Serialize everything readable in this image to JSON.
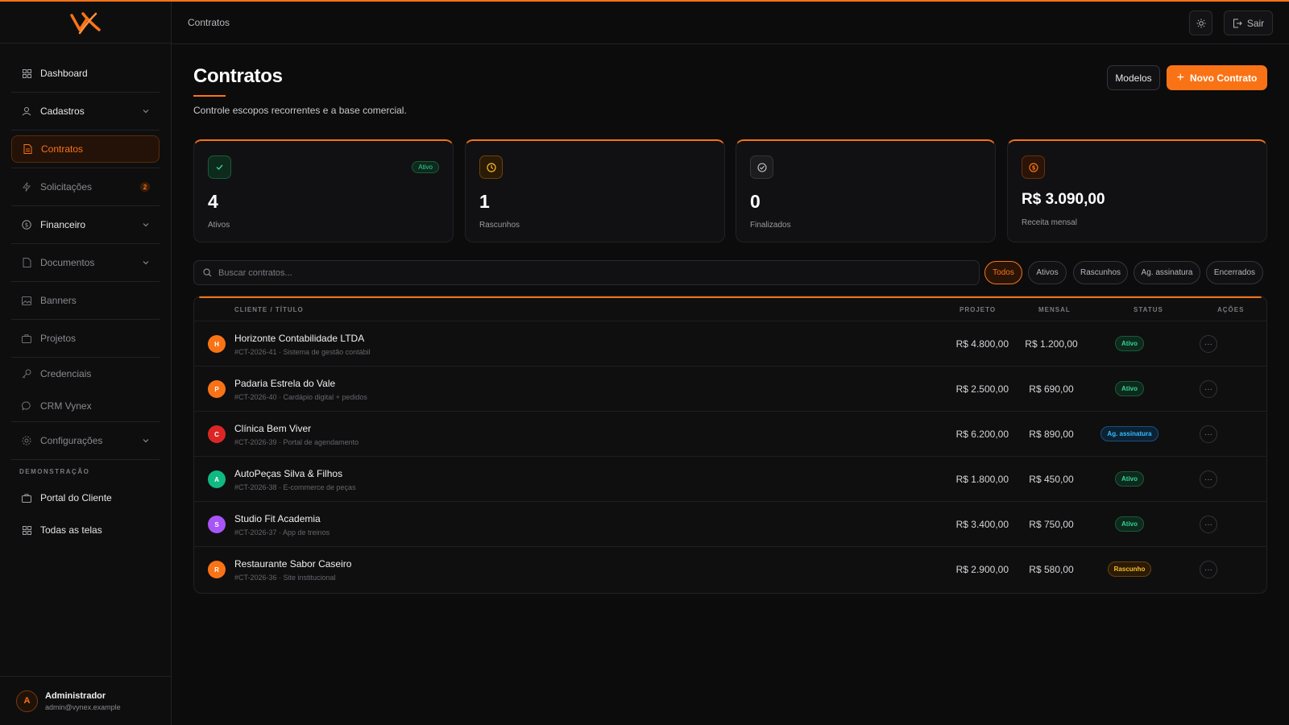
{
  "colors": {
    "accent": "#f97316",
    "success": "#34d399",
    "info": "#38bdf8",
    "warning": "#fbbf24"
  },
  "header": {
    "breadcrumb": "Contratos",
    "theme_icon": "sun-icon",
    "logout_label": "Sair"
  },
  "sidebar": {
    "items": [
      {
        "label": "Dashboard",
        "icon": "grid-icon"
      },
      {
        "label": "Cadastros",
        "icon": "users-icon"
      },
      {
        "label": "Contratos",
        "icon": "file-icon"
      },
      {
        "label": "Solicitações",
        "icon": "bolt-icon",
        "badge": "2"
      },
      {
        "label": "Financeiro",
        "icon": "dollar-icon"
      },
      {
        "label": "Documentos",
        "icon": "doc-icon"
      },
      {
        "label": "Banners",
        "icon": "image-icon"
      },
      {
        "label": "Projetos",
        "icon": "briefcase-icon"
      },
      {
        "label": "Credenciais",
        "icon": "key-icon"
      },
      {
        "label": "CRM Vynex",
        "icon": "chat-icon"
      },
      {
        "label": "Configurações",
        "icon": "gear-icon"
      }
    ],
    "section_label": "DEMONSTRAÇÃO",
    "demo_items": [
      {
        "label": "Portal do Cliente",
        "icon": "briefcase-icon"
      },
      {
        "label": "Todas as telas",
        "icon": "grid-icon"
      }
    ],
    "user": {
      "initial": "A",
      "name": "Administrador",
      "email": "admin@vynex.example"
    }
  },
  "page": {
    "title": "Contratos",
    "subtitle": "Controle escopos recorrentes e a base comercial.",
    "btn_modelos": "Modelos",
    "btn_novo": "Novo Contrato"
  },
  "stats": [
    {
      "value": "4",
      "label": "Ativos",
      "pill": "Ativo",
      "icon": "check-icon"
    },
    {
      "value": "1",
      "label": "Rascunhos",
      "icon": "clock-icon"
    },
    {
      "value": "0",
      "label": "Finalizados",
      "icon": "check-circle-icon"
    },
    {
      "value": "R$ 3.090,00",
      "label": "Receita mensal",
      "icon": "coin-icon"
    }
  ],
  "search": {
    "placeholder": "Buscar contratos..."
  },
  "filters": [
    "Todos",
    "Ativos",
    "Rascunhos",
    "Ag. assinatura",
    "Encerrados"
  ],
  "table": {
    "headers": {
      "client": "CLIENTE / TÍTULO",
      "project": "PROJETO",
      "monthly": "MENSAL",
      "status": "STATUS",
      "actions": "AÇÕES"
    },
    "rows": [
      {
        "initial": "H",
        "color": "#f97316",
        "name": "Horizonte Contabilidade LTDA",
        "sub": "#CT-2026-41 · Sistema de gestão contábil",
        "project": "R$ 4.800,00",
        "monthly": "R$ 1.200,00",
        "status": "Ativo",
        "status_type": "ativo"
      },
      {
        "initial": "P",
        "color": "#f97316",
        "name": "Padaria Estrela do Vale",
        "sub": "#CT-2026-40 · Cardápio digital + pedidos",
        "project": "R$ 2.500,00",
        "monthly": "R$ 690,00",
        "status": "Ativo",
        "status_type": "ativo"
      },
      {
        "initial": "C",
        "color": "#dc2626",
        "name": "Clínica Bem Viver",
        "sub": "#CT-2026-39 · Portal de agendamento",
        "project": "R$ 6.200,00",
        "monthly": "R$ 890,00",
        "status": "Ag. assinatura",
        "status_type": "ag"
      },
      {
        "initial": "A",
        "color": "#10b981",
        "name": "AutoPeças Silva & Filhos",
        "sub": "#CT-2026-38 · E-commerce de peças",
        "project": "R$ 1.800,00",
        "monthly": "R$ 450,00",
        "status": "Ativo",
        "status_type": "ativo"
      },
      {
        "initial": "S",
        "color": "#a855f7",
        "name": "Studio Fit Academia",
        "sub": "#CT-2026-37 · App de treinos",
        "project": "R$ 3.400,00",
        "monthly": "R$ 750,00",
        "status": "Ativo",
        "status_type": "ativo"
      },
      {
        "initial": "R",
        "color": "#f97316",
        "name": "Restaurante Sabor Caseiro",
        "sub": "#CT-2026-36 · Site institucional",
        "project": "R$ 2.900,00",
        "monthly": "R$ 580,00",
        "status": "Rascunho",
        "status_type": "rasc"
      }
    ]
  }
}
